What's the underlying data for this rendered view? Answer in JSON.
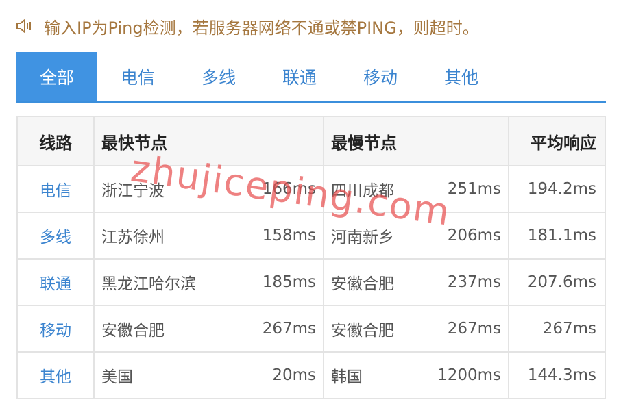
{
  "notice": {
    "icon": "speaker-muted-icon",
    "text": "输入IP为Ping检测，若服务器网络不通或禁PING，则超时。",
    "color": "#a5773f"
  },
  "tabs": [
    {
      "label": "全部",
      "active": true
    },
    {
      "label": "电信",
      "active": false
    },
    {
      "label": "多线",
      "active": false
    },
    {
      "label": "联通",
      "active": false
    },
    {
      "label": "移动",
      "active": false
    },
    {
      "label": "其他",
      "active": false
    }
  ],
  "table": {
    "headers": {
      "line": "线路",
      "fastest": "最快节点",
      "slowest": "最慢节点",
      "average": "平均响应"
    },
    "rows": [
      {
        "line": "电信",
        "fast_node": "浙江宁波",
        "fast_ms": "166ms",
        "slow_node": "四川成都",
        "slow_ms": "251ms",
        "avg": "194.2ms"
      },
      {
        "line": "多线",
        "fast_node": "江苏徐州",
        "fast_ms": "158ms",
        "slow_node": "河南新乡",
        "slow_ms": "206ms",
        "avg": "181.1ms"
      },
      {
        "line": "联通",
        "fast_node": "黑龙江哈尔滨",
        "fast_ms": "185ms",
        "slow_node": "安徽合肥",
        "slow_ms": "237ms",
        "avg": "207.6ms"
      },
      {
        "line": "移动",
        "fast_node": "安徽合肥",
        "fast_ms": "267ms",
        "slow_node": "安徽合肥",
        "slow_ms": "267ms",
        "avg": "267ms"
      },
      {
        "line": "其他",
        "fast_node": "美国",
        "fast_ms": "20ms",
        "slow_node": "韩国",
        "slow_ms": "1200ms",
        "avg": "144.3ms"
      }
    ]
  },
  "watermark": "zhujiceping.com",
  "colors": {
    "accent": "#4093e2",
    "link": "#3b84cf",
    "watermark": "#e85050"
  }
}
